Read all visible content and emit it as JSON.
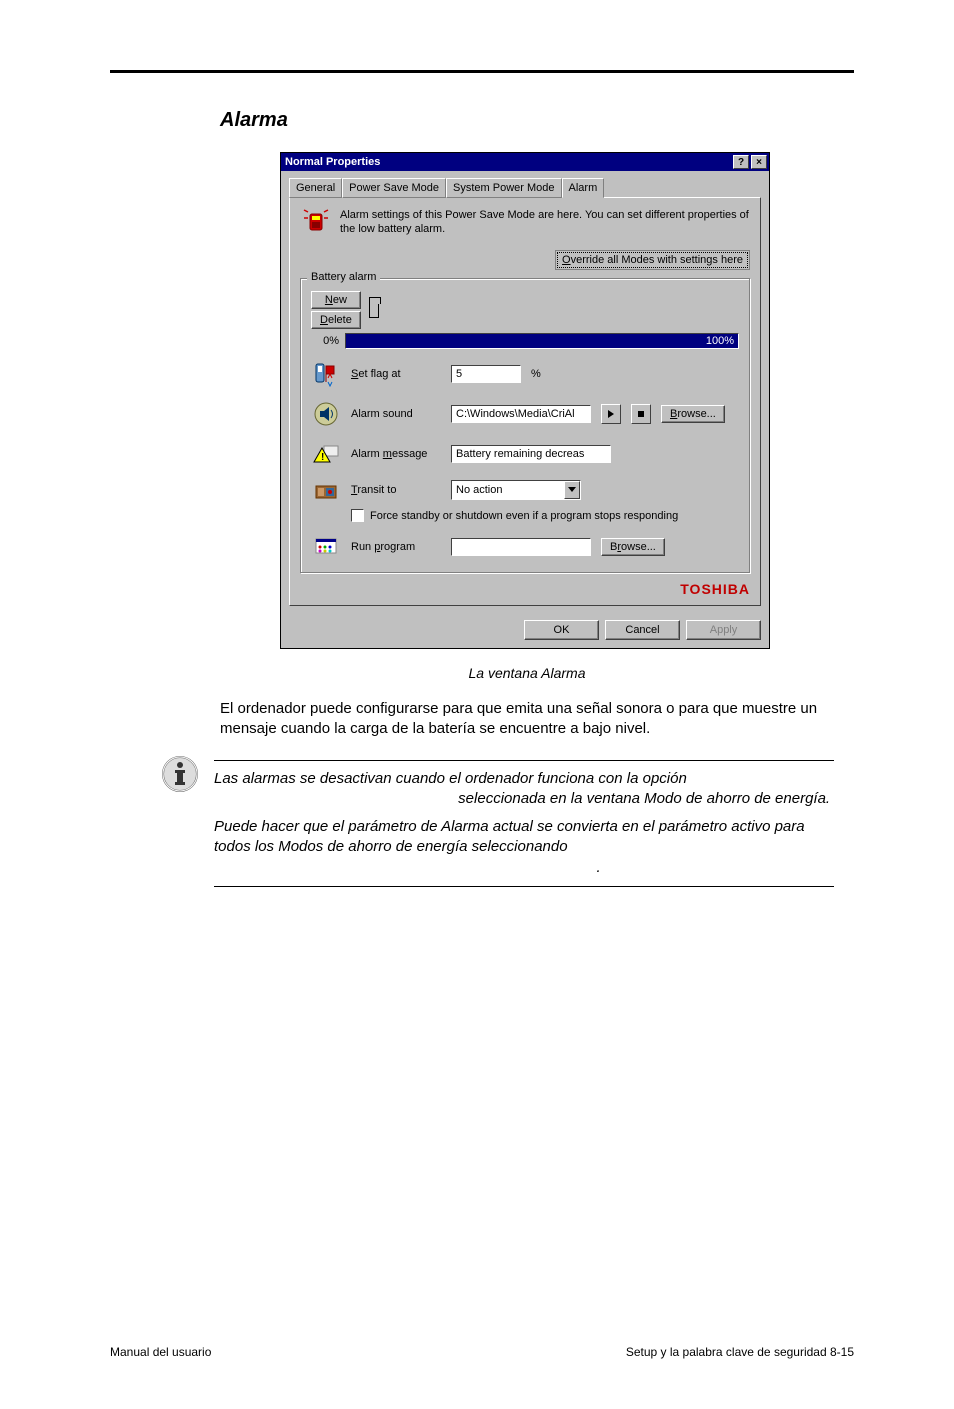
{
  "section_title": "Alarma",
  "dialog": {
    "title": "Normal Properties",
    "help_icon": "?",
    "close_icon": "×",
    "tabs": {
      "general": "General",
      "power_save": "Power Save Mode",
      "system_power": "System Power Mode",
      "alarm": "Alarm"
    },
    "description": "Alarm settings of this Power Save Mode are here. You can set different properties of the low battery alarm.",
    "override_button_prefix": "O",
    "override_button_rest": "verride all Modes with settings here",
    "group_title": "Battery alarm",
    "new_button_u": "N",
    "new_button_rest": "ew",
    "delete_button_u": "D",
    "delete_button_rest": "elete",
    "scale_min": "0%",
    "scale_max": "100%",
    "rows": {
      "set_flag": {
        "label_u": "S",
        "label_rest": "et flag at",
        "value": "5",
        "unit": "%"
      },
      "alarm_sound": {
        "label": "Alarm sound",
        "path": "C:\\Windows\\Media\\CriAl",
        "browse_u": "B",
        "browse_rest": "rowse..."
      },
      "alarm_message": {
        "label_pre": "Alarm ",
        "label_u": "m",
        "label_post": "essage",
        "value": "Battery remaining decreas"
      },
      "transit": {
        "label_u": "T",
        "label_rest": "ransit to",
        "value": "No action"
      },
      "force": {
        "label_u": "F",
        "label_rest": "orce standby or shutdown even if a program stops responding"
      },
      "run_program": {
        "label_pre": "Run ",
        "label_u": "p",
        "label_post": "rogram",
        "browse_pre": "B",
        "browse_u": "r",
        "browse_post": "owse..."
      }
    },
    "brand": "TOSHIBA",
    "buttons": {
      "ok": "OK",
      "cancel": "Cancel",
      "apply": "Apply"
    }
  },
  "caption": "La ventana Alarma",
  "body_paragraph": "El ordenador puede configurarse para que emita una señal sonora o para que muestre un mensaje cuando la carga de la batería se encuentre a bajo nivel.",
  "note": {
    "p1a": "Las alarmas se desactivan cuando el ordenador funciona con la opción",
    "p1b": "seleccionada en la ventana Modo de ahorro de energía.",
    "p2": "Puede hacer que el parámetro de Alarma actual se convierta en el parámetro activo para todos los Modos de ahorro de energía seleccionando",
    "p2_end": "."
  },
  "footer": {
    "left": "Manual del usuario",
    "right": "Setup y la palabra clave de seguridad  8-15"
  }
}
